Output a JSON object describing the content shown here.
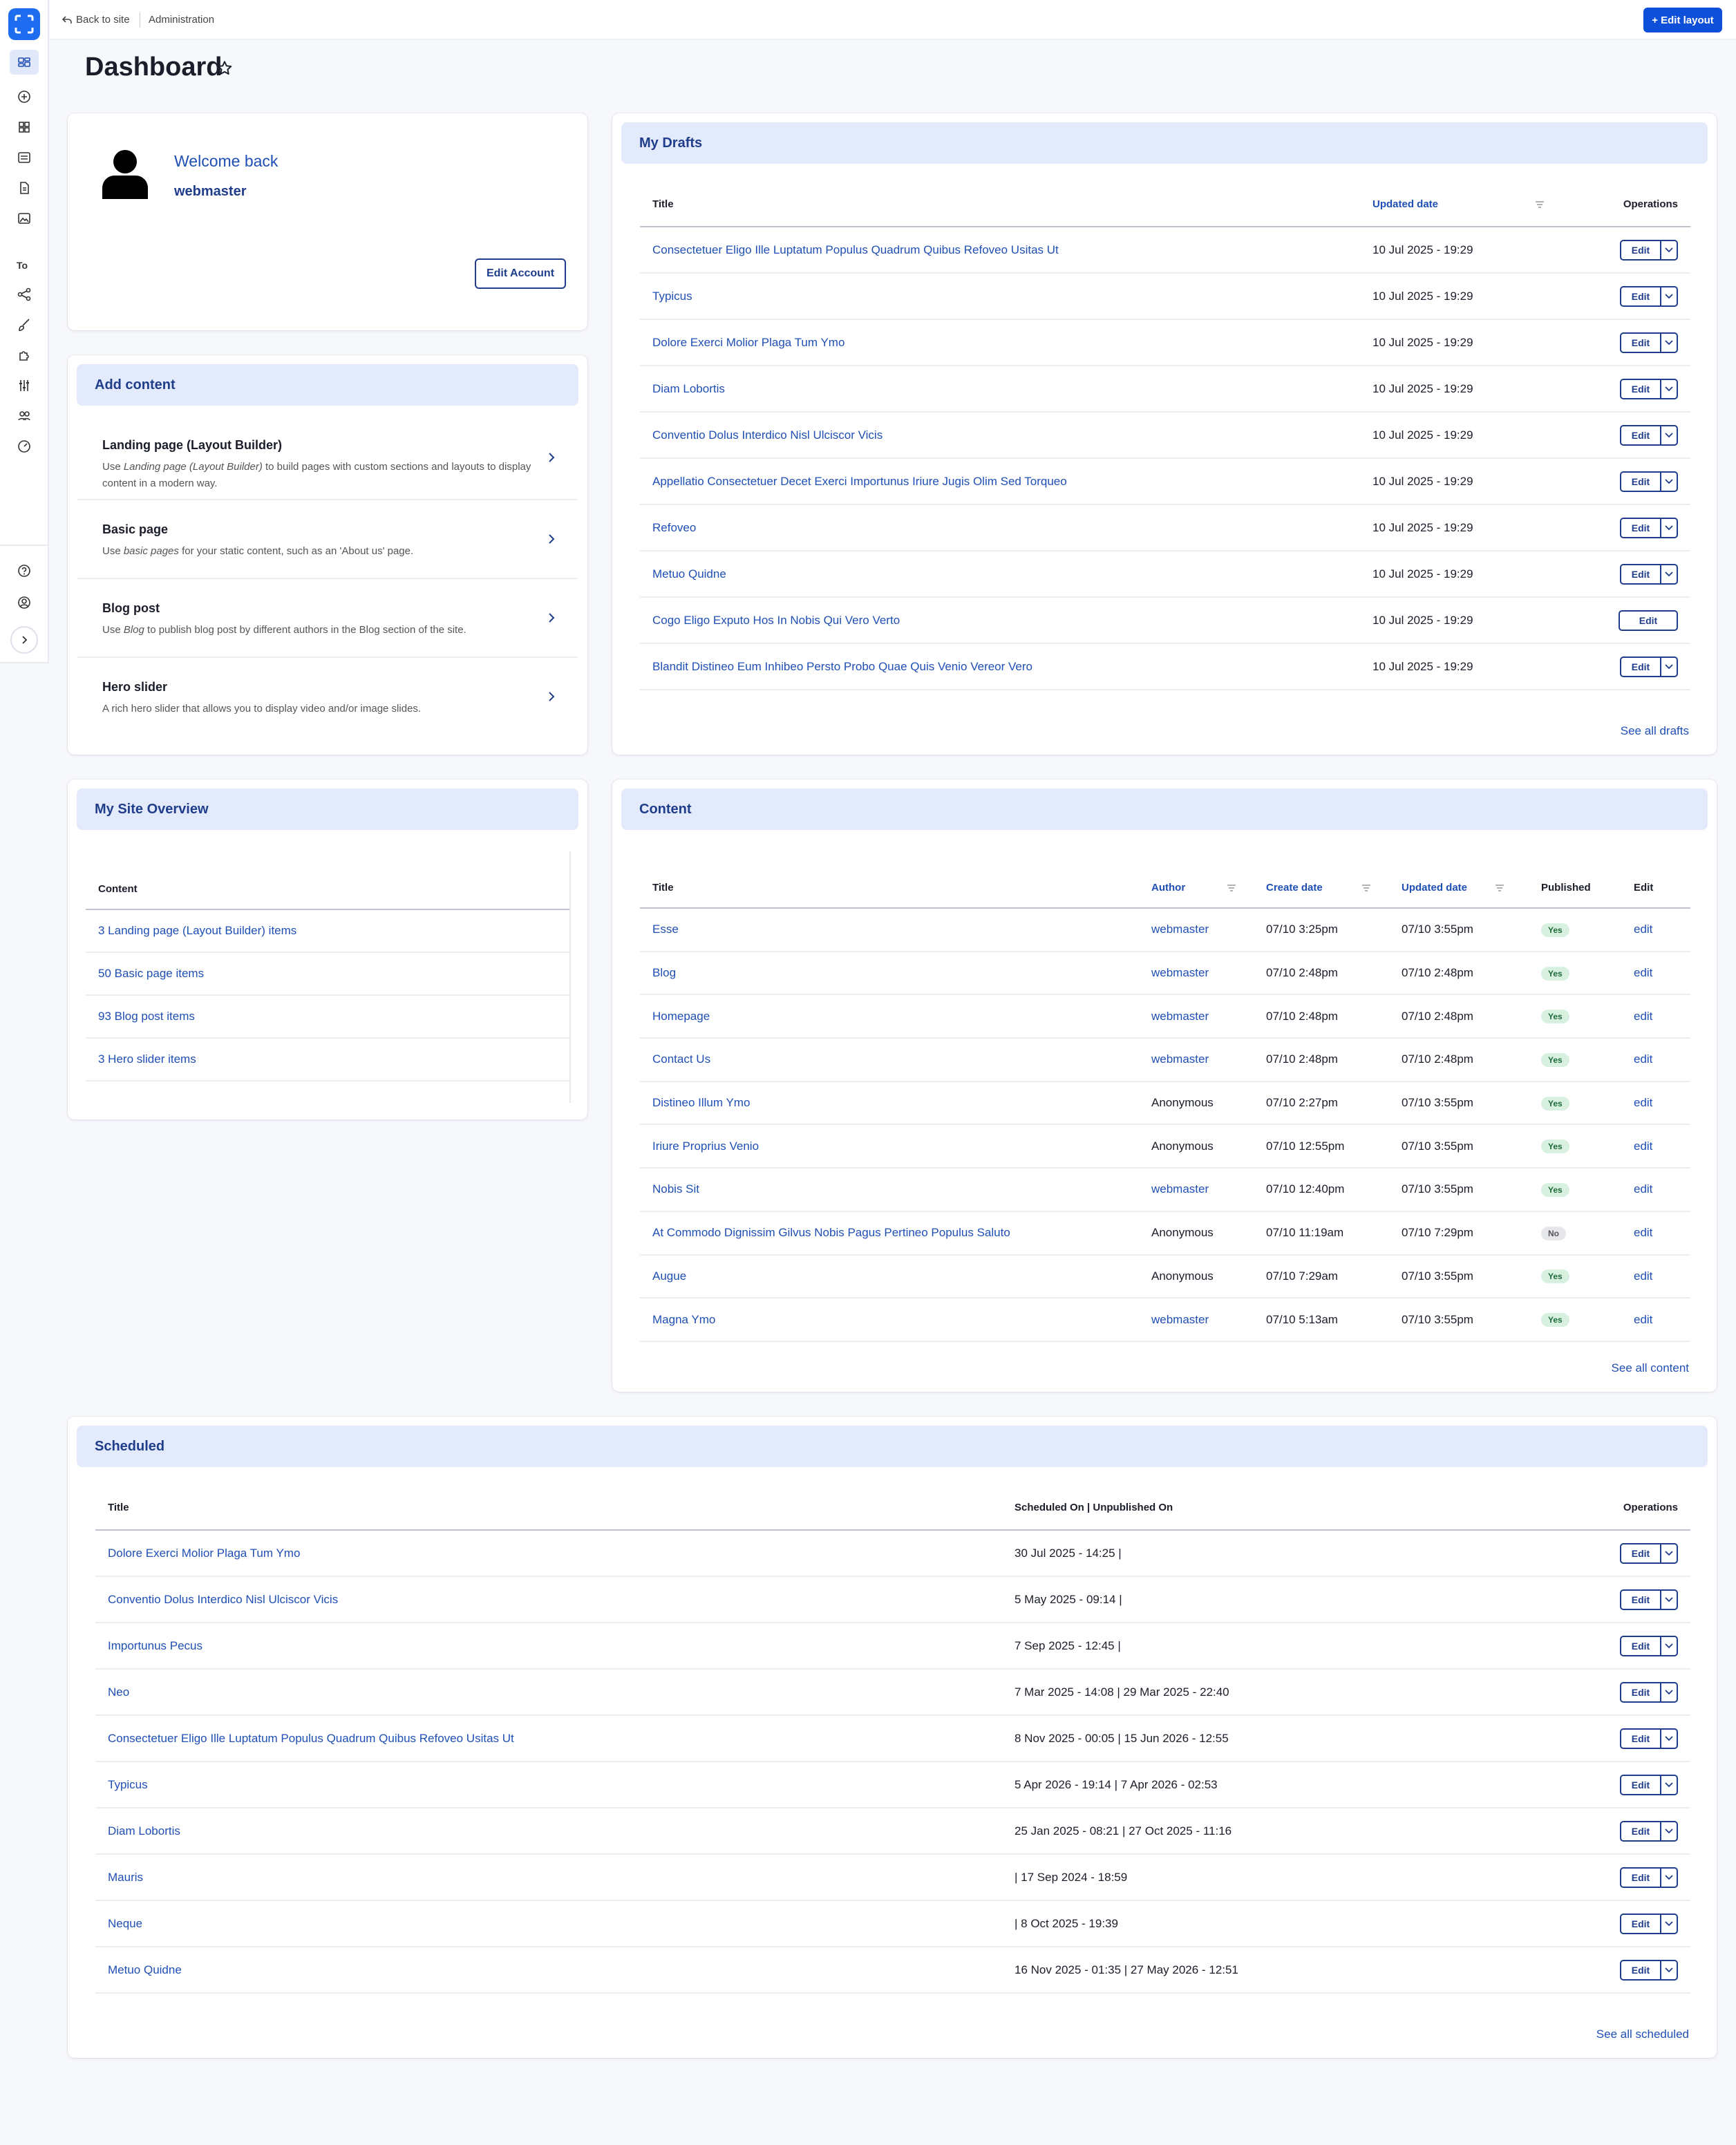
{
  "topbar": {
    "back_label": "Back to site",
    "breadcrumb": "Administration",
    "edit_layout": "+ Edit layout"
  },
  "page": {
    "title": "Dashboard"
  },
  "sidebar": {
    "section_label": "To",
    "icons": [
      "layout-icon",
      "plus-circle-icon",
      "grid-icon",
      "list-icon",
      "document-icon",
      "media-icon",
      "workflow-icon",
      "brush-icon",
      "puzzle-icon",
      "sliders-icon",
      "users-icon",
      "gauge-icon",
      "help-icon",
      "user-circle-icon"
    ]
  },
  "welcome": {
    "greeting": "Welcome back",
    "username": "webmaster",
    "edit_account": "Edit Account"
  },
  "add_content": {
    "title": "Add content",
    "items": [
      {
        "title": "Landing page (Layout Builder)",
        "desc_pre": "Use ",
        "desc_em": "Landing page (Layout Builder)",
        "desc_post": " to build pages with custom sections and layouts to display content in a modern way."
      },
      {
        "title": "Basic page",
        "desc_pre": "Use ",
        "desc_em": "basic pages",
        "desc_post": " for your static content, such as an 'About us' page."
      },
      {
        "title": "Blog post",
        "desc_pre": "Use ",
        "desc_em": "Blog",
        "desc_post": " to publish blog post by different authors in the Blog section of the site."
      },
      {
        "title": "Hero slider",
        "desc_pre": "",
        "desc_em": "",
        "desc_post": "A rich hero slider that allows you to display video and/or image slides."
      }
    ]
  },
  "site_overview": {
    "title": "My Site Overview",
    "header": "Content",
    "rows": [
      "3 Landing page (Layout Builder) items",
      "50 Basic page items",
      "93 Blog post items",
      "3 Hero slider items"
    ]
  },
  "drafts": {
    "title": "My Drafts",
    "headers": {
      "title": "Title",
      "updated": "Updated date",
      "ops": "Operations"
    },
    "edit_label": "Edit",
    "rows": [
      {
        "title": "Consectetuer Eligo Ille Luptatum Populus Quadrum Quibus Refoveo Usitas Ut",
        "date": "10 Jul 2025 - 19:29"
      },
      {
        "title": "Typicus",
        "date": "10 Jul 2025 - 19:29"
      },
      {
        "title": "Dolore Exerci Molior Plaga Tum Ymo",
        "date": "10 Jul 2025 - 19:29"
      },
      {
        "title": "Diam Lobortis",
        "date": "10 Jul 2025 - 19:29"
      },
      {
        "title": "Conventio Dolus Interdico Nisl Ulciscor Vicis",
        "date": "10 Jul 2025 - 19:29"
      },
      {
        "title": "Appellatio Consectetuer Decet Exerci Importunus Iriure Jugis Olim Sed Torqueo",
        "date": "10 Jul 2025 - 19:29"
      },
      {
        "title": "Refoveo",
        "date": "10 Jul 2025 - 19:29"
      },
      {
        "title": "Metuo Quidne",
        "date": "10 Jul 2025 - 19:29"
      },
      {
        "title": "Cogo Eligo Exputo Hos In Nobis Qui Vero Verto",
        "date": "10 Jul 2025 - 19:29"
      },
      {
        "title": "Blandit Distineo Eum Inhibeo Persto Probo Quae Quis Venio Vereor Vero",
        "date": "10 Jul 2025 - 19:29"
      }
    ],
    "see_all": "See all drafts"
  },
  "content": {
    "title": "Content",
    "headers": {
      "title": "Title",
      "author": "Author",
      "created": "Create date",
      "updated": "Updated date",
      "published": "Published",
      "edit": "Edit"
    },
    "rows": [
      {
        "title": "Esse",
        "author": "webmaster",
        "created": "07/10 3:25pm",
        "updated": "07/10 3:55pm",
        "published": "Yes"
      },
      {
        "title": "Blog",
        "author": "webmaster",
        "created": "07/10 2:48pm",
        "updated": "07/10 2:48pm",
        "published": "Yes"
      },
      {
        "title": "Homepage",
        "author": "webmaster",
        "created": "07/10 2:48pm",
        "updated": "07/10 2:48pm",
        "published": "Yes"
      },
      {
        "title": "Contact Us",
        "author": "webmaster",
        "created": "07/10 2:48pm",
        "updated": "07/10 2:48pm",
        "published": "Yes"
      },
      {
        "title": "Distineo Illum Ymo",
        "author": "Anonymous",
        "created": "07/10 2:27pm",
        "updated": "07/10 3:55pm",
        "published": "Yes"
      },
      {
        "title": "Iriure Proprius Venio",
        "author": "Anonymous",
        "created": "07/10 12:55pm",
        "updated": "07/10 3:55pm",
        "published": "Yes"
      },
      {
        "title": "Nobis Sit",
        "author": "webmaster",
        "created": "07/10 12:40pm",
        "updated": "07/10 3:55pm",
        "published": "Yes"
      },
      {
        "title": "At Commodo Dignissim Gilvus Nobis Pagus Pertineo Populus Saluto",
        "author": "Anonymous",
        "created": "07/10 11:19am",
        "updated": "07/10 7:29pm",
        "published": "No"
      },
      {
        "title": "Augue",
        "author": "Anonymous",
        "created": "07/10 7:29am",
        "updated": "07/10 3:55pm",
        "published": "Yes"
      },
      {
        "title": "Magna Ymo",
        "author": "webmaster",
        "created": "07/10 5:13am",
        "updated": "07/10 3:55pm",
        "published": "Yes"
      }
    ],
    "edit_link": "edit",
    "see_all": "See all content"
  },
  "scheduled": {
    "title": "Scheduled",
    "headers": {
      "title": "Title",
      "dates": "Scheduled On | Unpublished On",
      "ops": "Operations"
    },
    "edit_label": "Edit",
    "rows": [
      {
        "title": "Dolore Exerci Molior Plaga Tum Ymo",
        "dates": "30 Jul 2025 - 14:25 |"
      },
      {
        "title": "Conventio Dolus Interdico Nisl Ulciscor Vicis",
        "dates": "5 May 2025 - 09:14 |"
      },
      {
        "title": "Importunus Pecus",
        "dates": "7 Sep 2025 - 12:45 |"
      },
      {
        "title": "Neo",
        "dates": "7 Mar 2025 - 14:08 | 29 Mar 2025 - 22:40"
      },
      {
        "title": "Consectetuer Eligo Ille Luptatum Populus Quadrum Quibus Refoveo Usitas Ut",
        "dates": "8 Nov 2025 - 00:05 | 15 Jun 2026 - 12:55"
      },
      {
        "title": "Typicus",
        "dates": "5 Apr 2026 - 19:14 | 7 Apr 2026 - 02:53"
      },
      {
        "title": "Diam Lobortis",
        "dates": "25 Jan 2025 - 08:21 | 27 Oct 2025 - 11:16"
      },
      {
        "title": "Mauris",
        "dates": "| 17 Sep 2024 - 18:59"
      },
      {
        "title": "Neque",
        "dates": "| 8 Oct 2025 - 19:39"
      },
      {
        "title": "Metuo Quidne",
        "dates": "16 Nov 2025 - 01:35 | 27 May 2026 - 12:51"
      }
    ],
    "see_all": "See all scheduled"
  }
}
